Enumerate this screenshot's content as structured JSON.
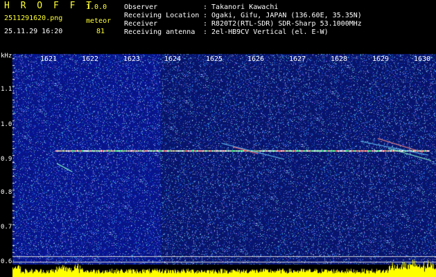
{
  "app": {
    "name": "H R O F F T",
    "version": "1.0.0",
    "filename": "2511291620.png",
    "mode": "meteor",
    "datetime": "25.11.29 16:20",
    "count": "81"
  },
  "info": {
    "labels": [
      "Observer",
      "Receiving Location",
      "Receiver",
      "Receiving antenna"
    ],
    "values": [
      ": Takanori Kawachi",
      ": Ogaki, Gifu, JAPAN (136.60E, 35.35N)",
      ": R820T2(RTL-SDR) SDR-Sharp 53.1000MHz",
      ": 2el-HB9CV Vertical (el. E-W)"
    ]
  },
  "axis": {
    "unit": "kHz",
    "x_ticks": [
      "1621",
      "1622",
      "1623",
      "1624",
      "1625",
      "1626",
      "1627",
      "1628",
      "1629",
      "1630"
    ],
    "y_ticks": [
      "1.1",
      "1.0",
      "0.9",
      "0.8",
      "0.7",
      "0.6"
    ]
  },
  "colors": {
    "background": "#000000",
    "header_title": "#ffff33",
    "waterfall_base": "#0a1a8a",
    "carrier": "#ffffff",
    "meteor": "#ff6060",
    "power_trace": "#ffff00"
  }
}
